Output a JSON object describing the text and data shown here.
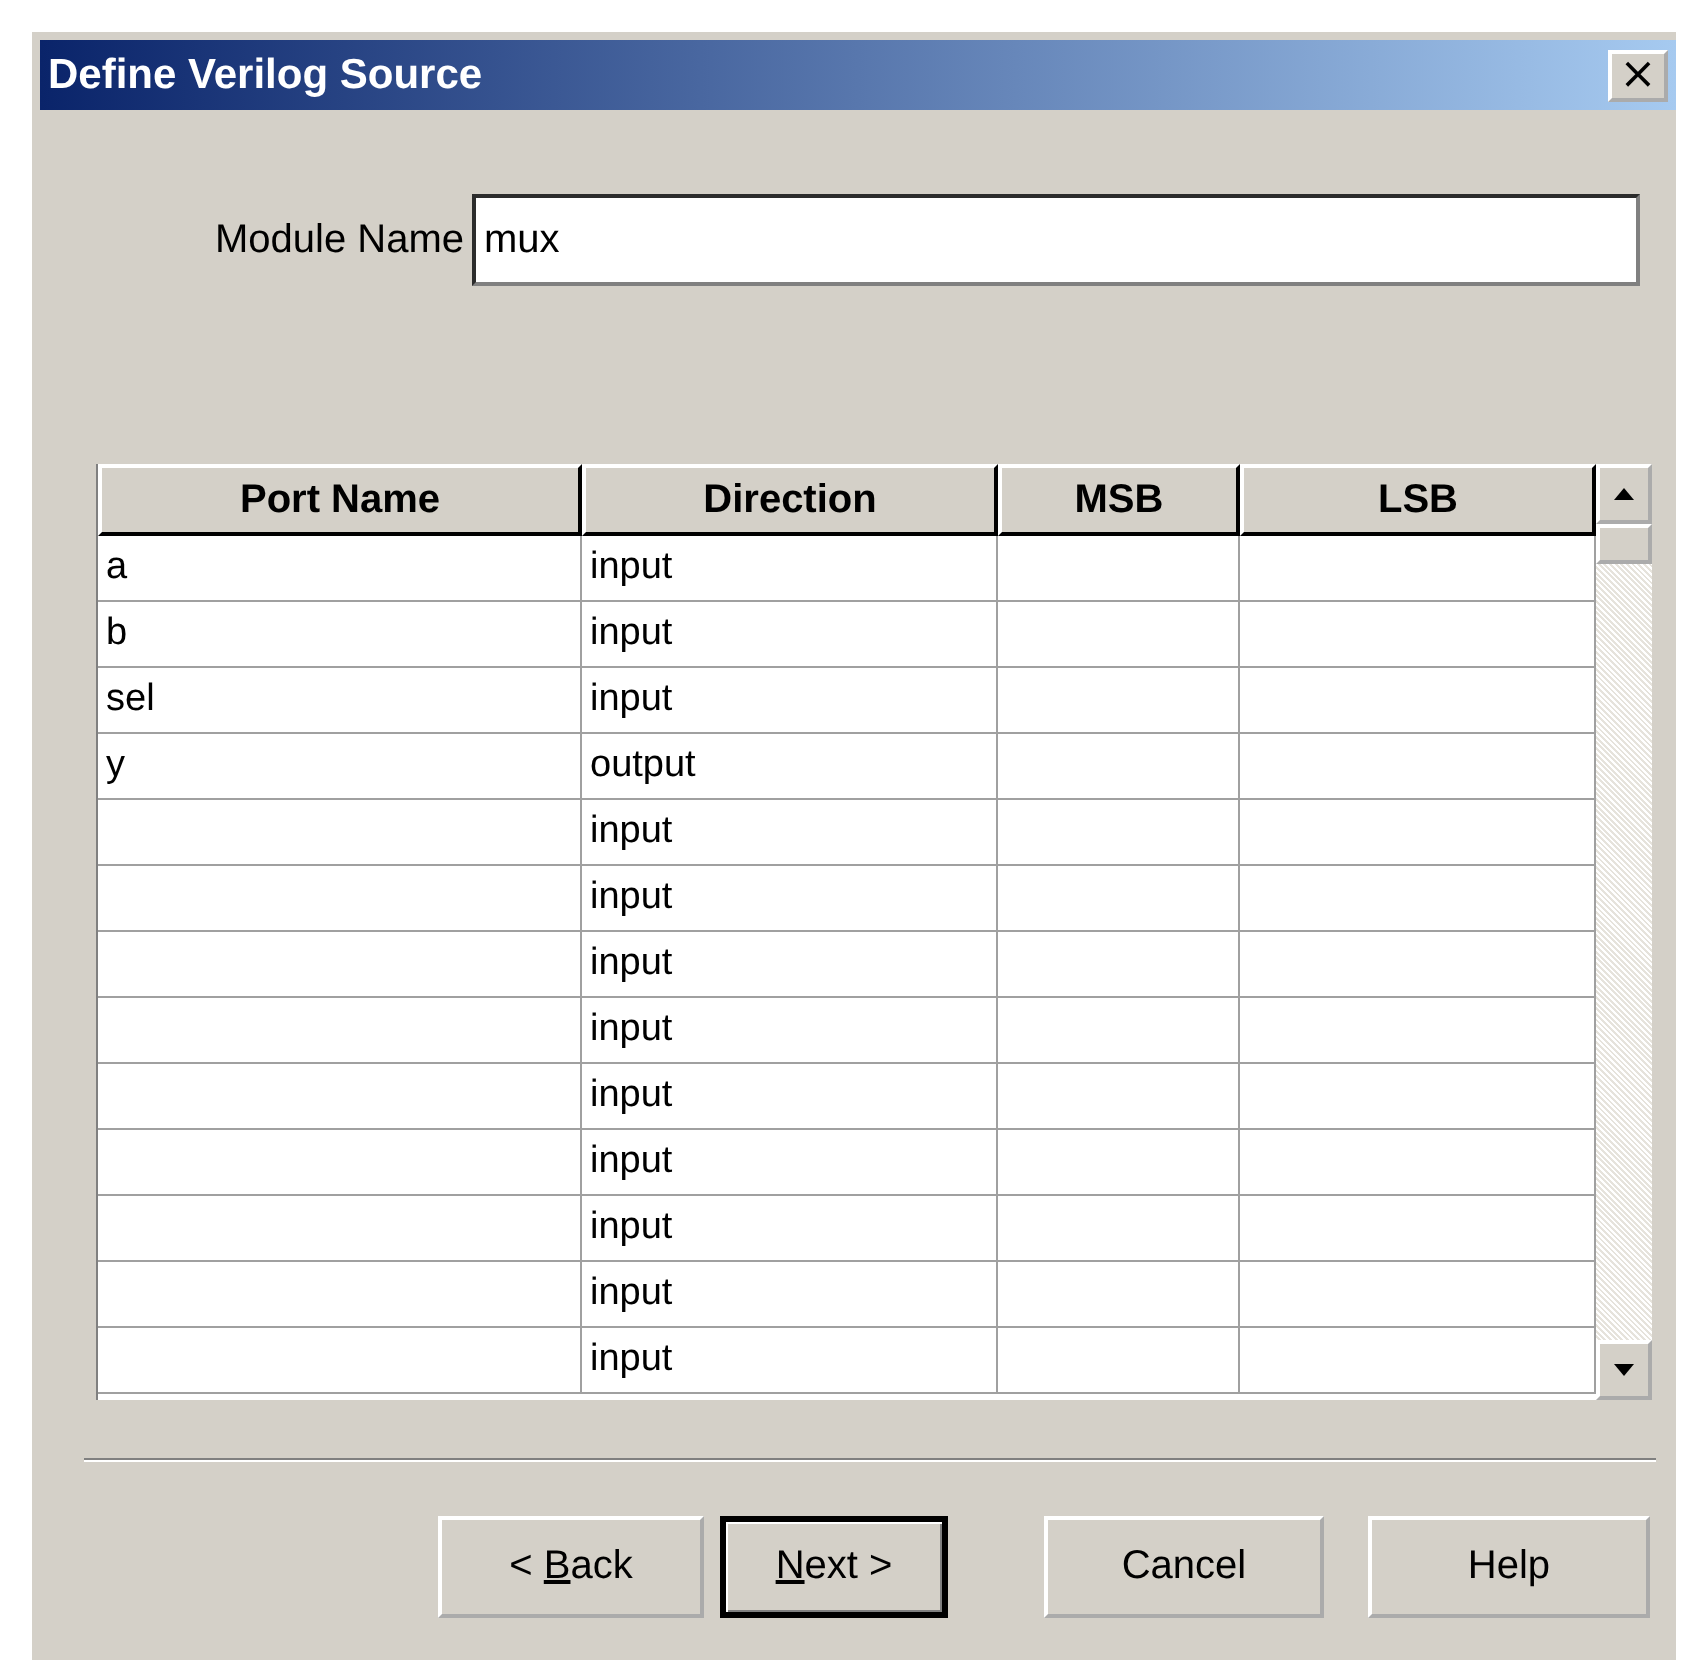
{
  "window": {
    "title": "Define Verilog Source",
    "close": "×"
  },
  "module_name": {
    "label": "Module Name",
    "value": "mux"
  },
  "table": {
    "columns": [
      "Port Name",
      "Direction",
      "MSB",
      "LSB"
    ],
    "rows": [
      {
        "cells": [
          "a",
          "input",
          "",
          ""
        ]
      },
      {
        "cells": [
          "b",
          "input",
          "",
          ""
        ]
      },
      {
        "cells": [
          "sel",
          "input",
          "",
          ""
        ]
      },
      {
        "cells": [
          "y",
          "output",
          "",
          ""
        ]
      },
      {
        "cells": [
          "",
          "input",
          "",
          ""
        ]
      },
      {
        "cells": [
          "",
          "input",
          "",
          ""
        ]
      },
      {
        "cells": [
          "",
          "input",
          "",
          ""
        ]
      },
      {
        "cells": [
          "",
          "input",
          "",
          ""
        ]
      },
      {
        "cells": [
          "",
          "input",
          "",
          ""
        ]
      },
      {
        "cells": [
          "",
          "input",
          "",
          ""
        ]
      },
      {
        "cells": [
          "",
          "input",
          "",
          ""
        ]
      },
      {
        "cells": [
          "",
          "input",
          "",
          ""
        ]
      },
      {
        "cells": [
          "",
          "input",
          "",
          ""
        ]
      }
    ]
  },
  "buttons": [
    {
      "label_parts": [
        {
          "text": "< ",
          "underline": false
        },
        {
          "text": "B",
          "underline": true
        },
        {
          "text": "ack",
          "underline": false
        }
      ],
      "default": false
    },
    {
      "label_parts": [
        {
          "text": "N",
          "underline": true
        },
        {
          "text": "ext >",
          "underline": false
        }
      ],
      "default": true
    },
    {
      "label_parts": [
        {
          "text": "Cancel",
          "underline": false
        }
      ],
      "default": false
    },
    {
      "label_parts": [
        {
          "text": "Help",
          "underline": false
        }
      ],
      "default": false
    }
  ]
}
